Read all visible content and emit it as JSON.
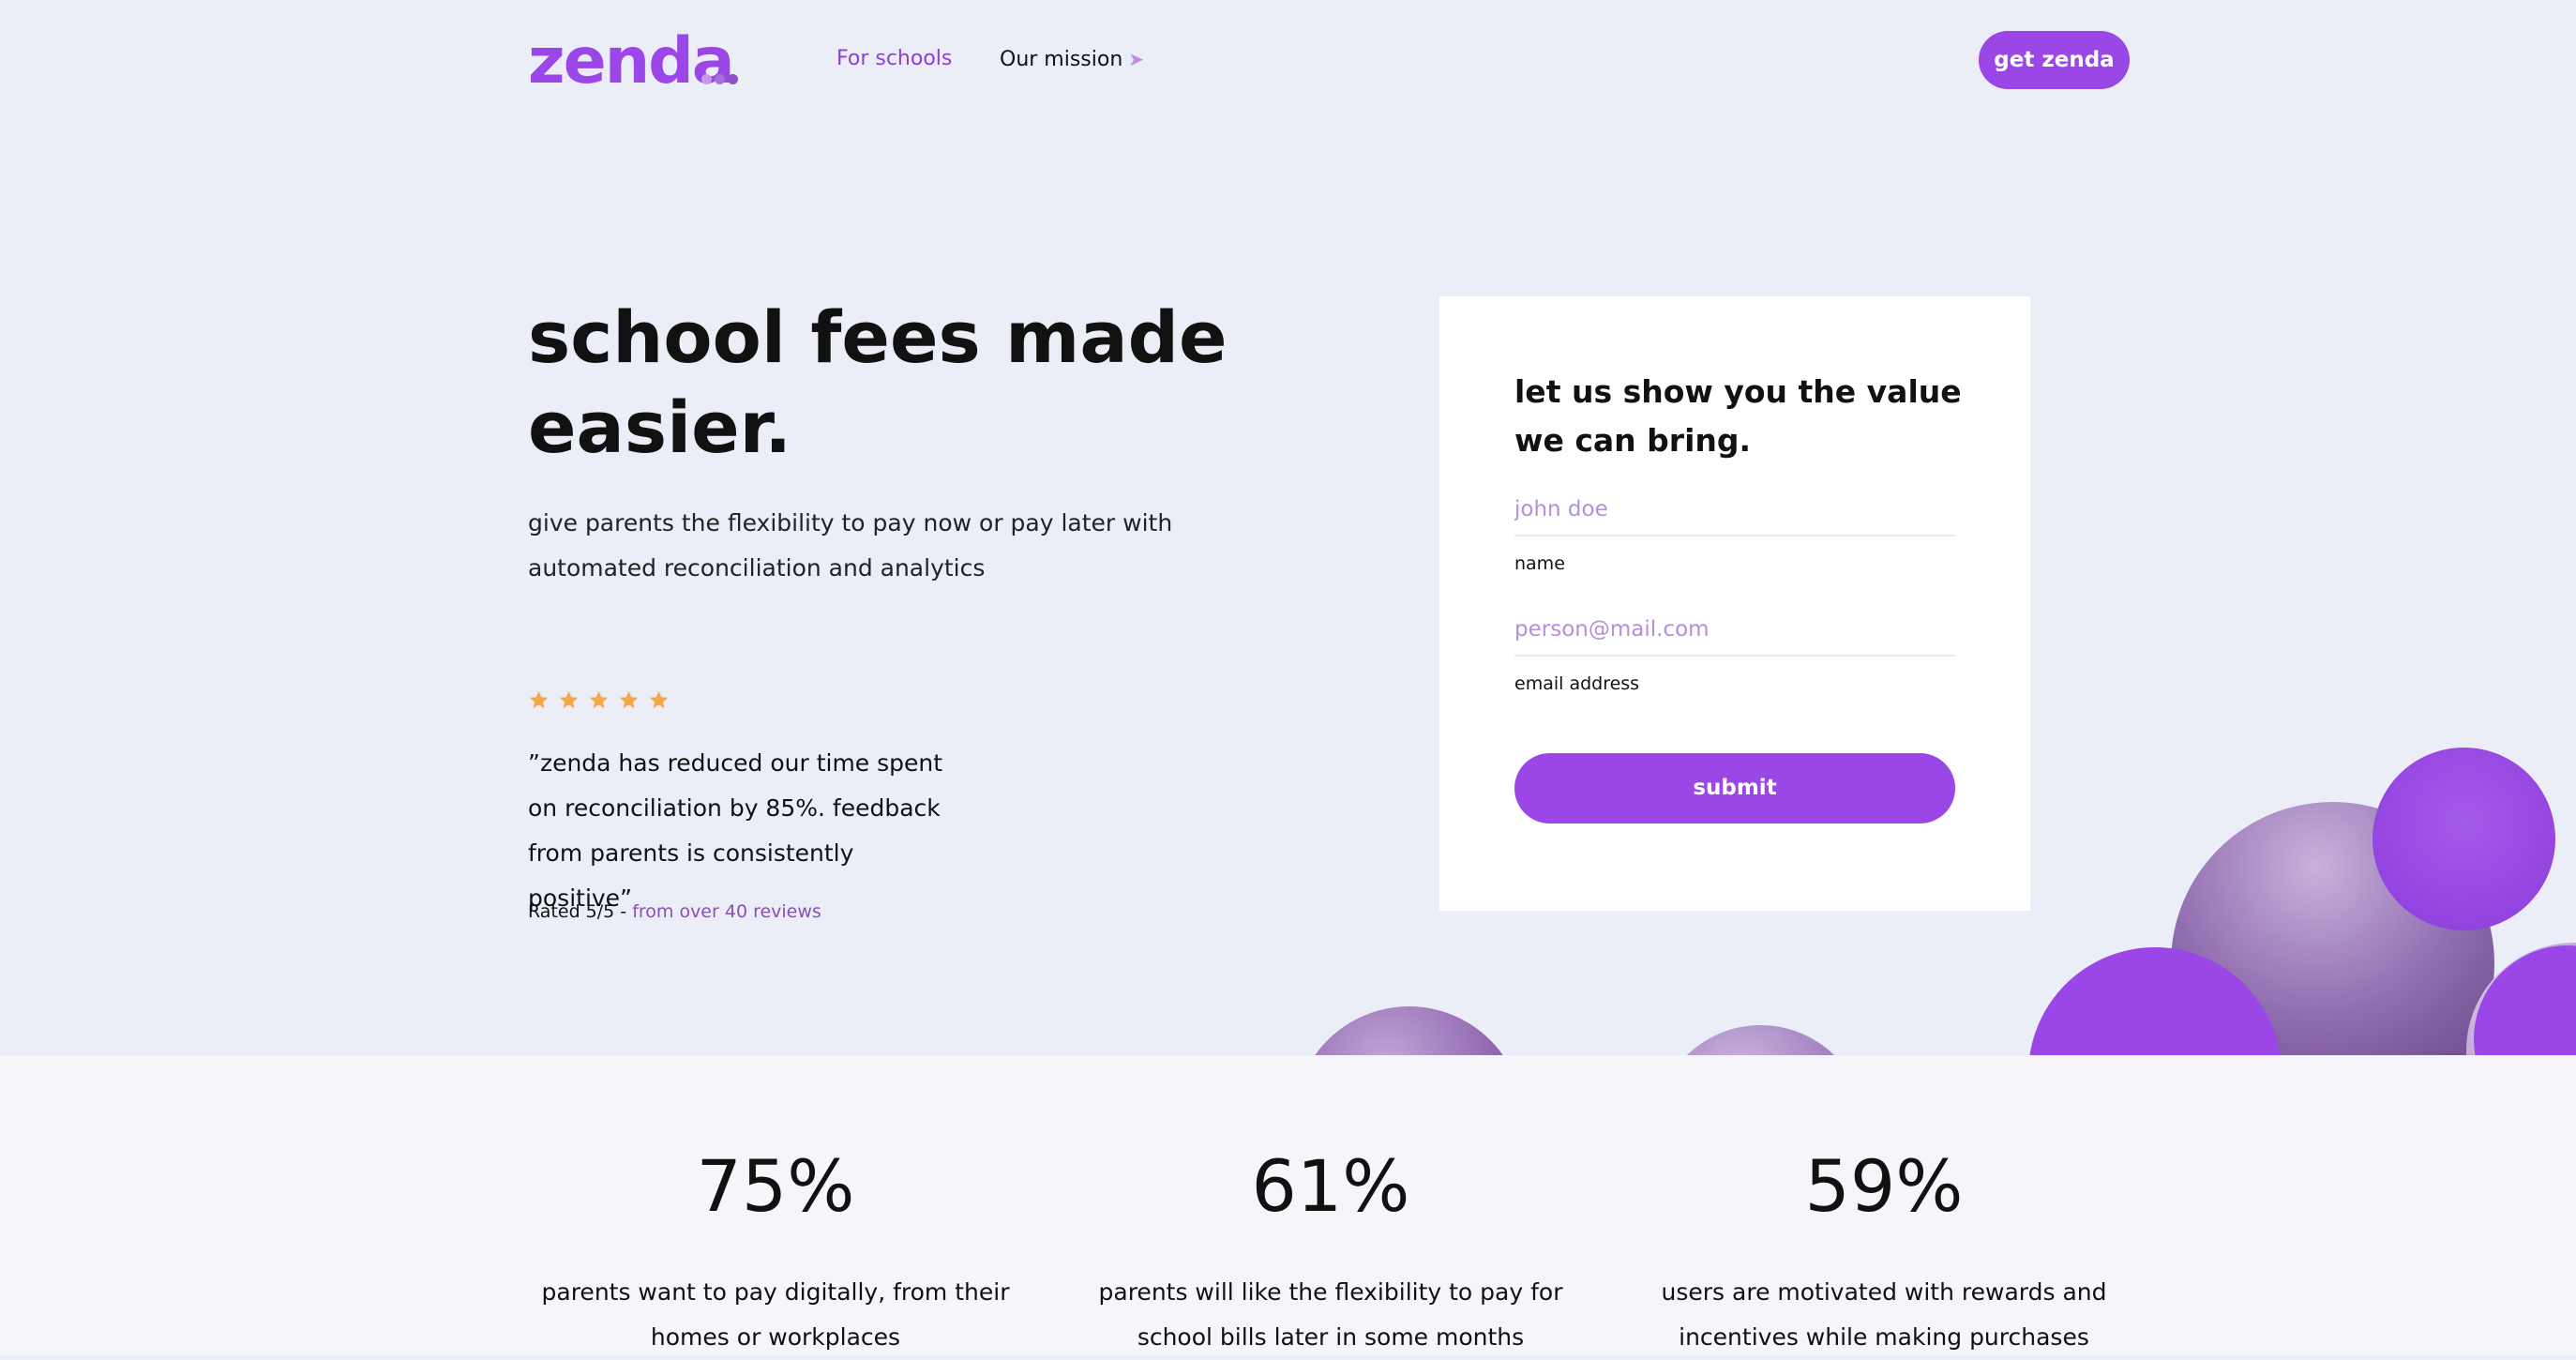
{
  "header": {
    "logo": "zenda",
    "logo_dot_colors": [
      "#c79ae8",
      "#a96fd8",
      "#8f52c4"
    ],
    "nav": {
      "for_schools": "For schools",
      "our_mission": "Our mission",
      "mission_icon": "rocket-icon"
    },
    "cta_label": "get zenda"
  },
  "hero": {
    "title": "school fees made easier.",
    "subtitle": "give parents the flexibility to pay now or pay later with automated reconciliation and analytics",
    "rating_stars": 5,
    "star_color": "#f2a84b",
    "quote": "”zenda has reduced our time spent on reconciliation by 85%. feedback from parents is consistently positive”",
    "rated_label": "Rated 5/5 - ",
    "reviews_label": "from over 40 reviews"
  },
  "form": {
    "title": "let us show you the value we can bring.",
    "name_placeholder": "john doe",
    "name_label": "name",
    "email_placeholder": "person@mail.com",
    "email_label": "email address",
    "submit_label": "submit"
  },
  "stats": [
    {
      "value": "75%",
      "description": "parents want to pay digitally, from their homes or workplaces"
    },
    {
      "value": "61%",
      "description": "parents will like the flexibility to pay for school bills later in some months"
    },
    {
      "value": "59%",
      "description": "users are motivated with rewards and incentives while making purchases"
    }
  ],
  "colors": {
    "accent": "#9b47e8",
    "page_bg": "#eceef7",
    "stats_bg": "#f5f5fa",
    "text": "#111111"
  }
}
